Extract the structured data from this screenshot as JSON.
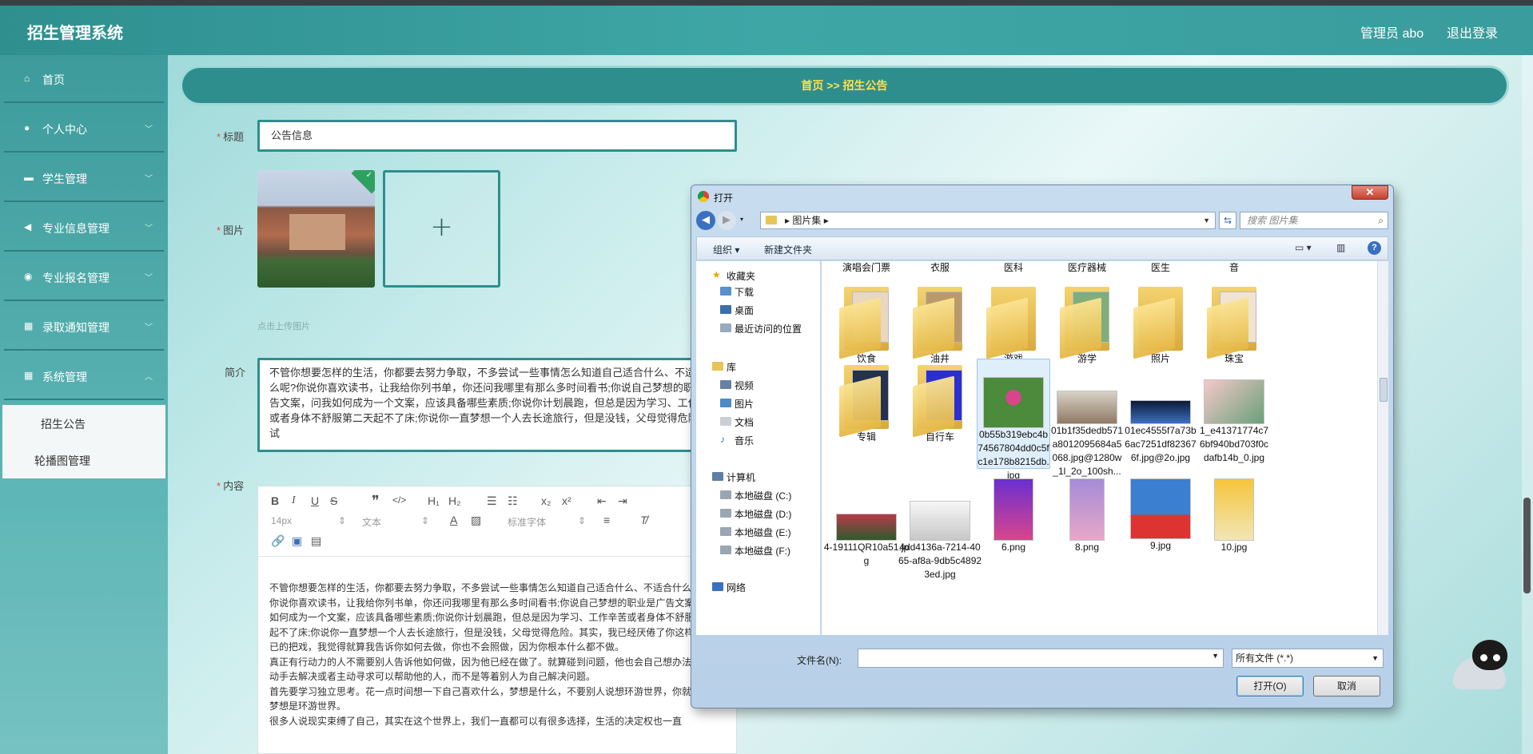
{
  "app": {
    "title": "招生管理系统",
    "admin": "管理员 abo",
    "logout": "退出登录"
  },
  "sidebar": {
    "items": [
      {
        "label": "首页",
        "icon": "home-icon"
      },
      {
        "label": "个人中心",
        "icon": "user-icon"
      },
      {
        "label": "学生管理",
        "icon": "briefcase-icon"
      },
      {
        "label": "专业信息管理",
        "icon": "megaphone-icon"
      },
      {
        "label": "专业报名管理",
        "icon": "lightbulb-icon"
      },
      {
        "label": "录取通知管理",
        "icon": "grid-icon"
      },
      {
        "label": "系统管理",
        "icon": "grid-icon"
      }
    ],
    "subitems": [
      {
        "label": "招生公告"
      },
      {
        "label": "轮播图管理"
      }
    ]
  },
  "breadcrumb": {
    "text": "首页  >>  招生公告"
  },
  "form": {
    "title_label": "标题",
    "title_value": "公告信息",
    "image_label": "图片",
    "upload_hint": "点击上传图片",
    "intro_label": "简介",
    "intro_value": "不管你想要怎样的生活，你都要去努力争取，不多尝试一些事情怎么知道自己适合什么、不适合什么呢?你说你喜欢读书，让我给你列书单，你还问我哪里有那么多时间看书;你说自己梦想的职业是广告文案，问我如何成为一个文案，应该具备哪些素质;你说你计划晨跑，但总是因为学习、工作辛苦或者身体不舒服第二天起不了床;你说你一直梦想一个人去长途旅行，但是没钱，父母觉得危险。测试",
    "content_label": "内容",
    "toolbar": {
      "font_size": "14px",
      "text_style": "文本",
      "font_family": "标准字体"
    },
    "content_lines": [
      "不管你想要怎样的生活，你都要去努力争取，不多尝试一些事情怎么知道自己适合什么、不适合什么呢?",
      "你说你喜欢读书，让我给你列书单，你还问我哪里有那么多时间看书;你说自己梦想的职业是广告文案，问我如何成为一个文案，应该具备哪些素质;你说你计划晨跑，但总是因为学习、工作辛苦或者身体不舒服第二天起不了床;你说你一直梦想一个人去长途旅行，但是没钱，父母觉得危险。其实，我已经厌倦了你这样说说而已的把戏，我觉得就算我告诉你如何去做，你也不会照做，因为你根本什么都不做。",
      "真正有行动力的人不需要别人告诉他如何做，因为他已经在做了。就算碰到问题，他也会自己想办法，自己动手去解决或者主动寻求可以帮助他的人，而不是等着别人为自己解决问题。",
      "首先要学习独立思考。花一点时间想一下自己喜欢什么，梦想是什么，不要别人说想环游世界，你就说你的梦想是环游世界。",
      "很多人说现实束缚了自己，其实在这个世界上，我们一直都可以有很多选择，生活的决定权也一直"
    ]
  },
  "dialog": {
    "title": "打开",
    "close": "✕",
    "path": "图片集",
    "search_placeholder": "搜索 图片集",
    "organize": "组织 ▾",
    "new_folder": "新建文件夹",
    "nav": {
      "favorites": "收藏夹",
      "fav_items": [
        "下载",
        "桌面",
        "最近访问的位置"
      ],
      "libraries": "库",
      "lib_items": [
        "视频",
        "图片",
        "文档",
        "音乐"
      ],
      "computer": "计算机",
      "drives": [
        "本地磁盘 (C:)",
        "本地磁盘 (D:)",
        "本地磁盘 (E:)",
        "本地磁盘 (F:)"
      ],
      "network": "网络"
    },
    "top_row": [
      "演唱会门票",
      "衣服",
      "医科",
      "医疗器械",
      "医生",
      "音"
    ],
    "folders_row1": [
      "饮食",
      "油井",
      "游戏",
      "游学",
      "照片",
      "珠宝"
    ],
    "row2": [
      "专辑",
      "自行车",
      "0b55b319ebc4b74567804dd0c5fc1e178b8215db.jpg",
      "01b1f35dedb571a8012095684a5068.jpg@1280w_1l_2o_100sh...",
      "01ec4555f7a73b6ac7251df823676f.jpg@2o.jpg",
      "1_e41371774c76bf940bd703f0cdafb14b_0.jpg"
    ],
    "row3": [
      "4-19111QR10a51.jpg",
      "4dd4136a-7214-4065-af8a-9db5c48923ed.jpg",
      "6.png",
      "8.png",
      "9.jpg",
      "10.jpg"
    ],
    "filename_label": "文件名(N):",
    "filetype": "所有文件 (*.*)",
    "open_btn": "打开(O)",
    "cancel_btn": "取消"
  },
  "colors": {
    "teal": "#2e8e8e",
    "breadcrumb_text": "#ffe14a"
  }
}
